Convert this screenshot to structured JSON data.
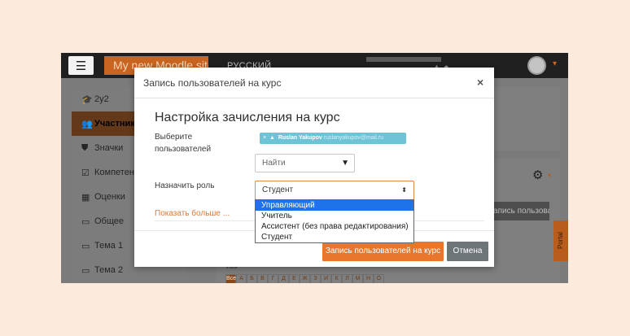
{
  "navbar": {
    "menu_icon": "☰",
    "site_name": "My new Moodle site",
    "language": "РУССКИЙ",
    "nav_icons": "▲ ●",
    "avatar_caret": "▾"
  },
  "sidebar": {
    "items": [
      {
        "icon": "graduation-cap-icon",
        "glyph": "🎓",
        "label": "2y2"
      },
      {
        "icon": "users-icon",
        "glyph": "👥",
        "label": "Участники"
      },
      {
        "icon": "shield-icon",
        "glyph": "⛊",
        "label": "Значки"
      },
      {
        "icon": "checkbox-icon",
        "glyph": "☑",
        "label": "Компетенции"
      },
      {
        "icon": "table-icon",
        "glyph": "▦",
        "label": "Оценки"
      },
      {
        "icon": "folder-icon",
        "glyph": "▭",
        "label": "Общее"
      },
      {
        "icon": "folder-icon",
        "glyph": "▭",
        "label": "Тема 1"
      },
      {
        "icon": "folder-icon",
        "glyph": "▭",
        "label": "Тема 2"
      }
    ]
  },
  "background": {
    "gear_icon": "⚙",
    "gear_caret": "▾",
    "enroll_button_label": "Запись пользователей на курс",
    "portal_tab_label": "Portal",
    "alpha_label": "Имя",
    "alphabet": [
      "Все",
      "А",
      "Б",
      "В",
      "Г",
      "Д",
      "Е",
      "Ж",
      "З",
      "И",
      "К",
      "Л",
      "М",
      "Н",
      "О"
    ]
  },
  "modal": {
    "title": "Запись пользователей на курс",
    "close_icon": "×",
    "section_title": "Настройка зачисления на курс",
    "select_users_label": "Выберите пользователей",
    "selected_user": {
      "remove": "×",
      "name": "Ruslan Yakupov",
      "email": "ruslanyakupov@mail.ru"
    },
    "search_placeholder": "Найти",
    "search_caret": "▼",
    "assign_role_label": "Назначить роль",
    "role_selected": "Студент",
    "role_arrow": "⬍",
    "role_options": [
      "Управляющий",
      "Учитель",
      "Ассистент (без права редактирования)",
      "Студент"
    ],
    "highlighted_option_index": 0,
    "show_more": "Показать больше ...",
    "submit_label": "Запись пользователей на курс",
    "cancel_label": "Отмена"
  },
  "colors": {
    "accent_orange": "#e8772d",
    "highlight_blue": "#1e73e8",
    "chip_teal": "#6ec3d7",
    "cancel_gray": "#6d7579"
  }
}
